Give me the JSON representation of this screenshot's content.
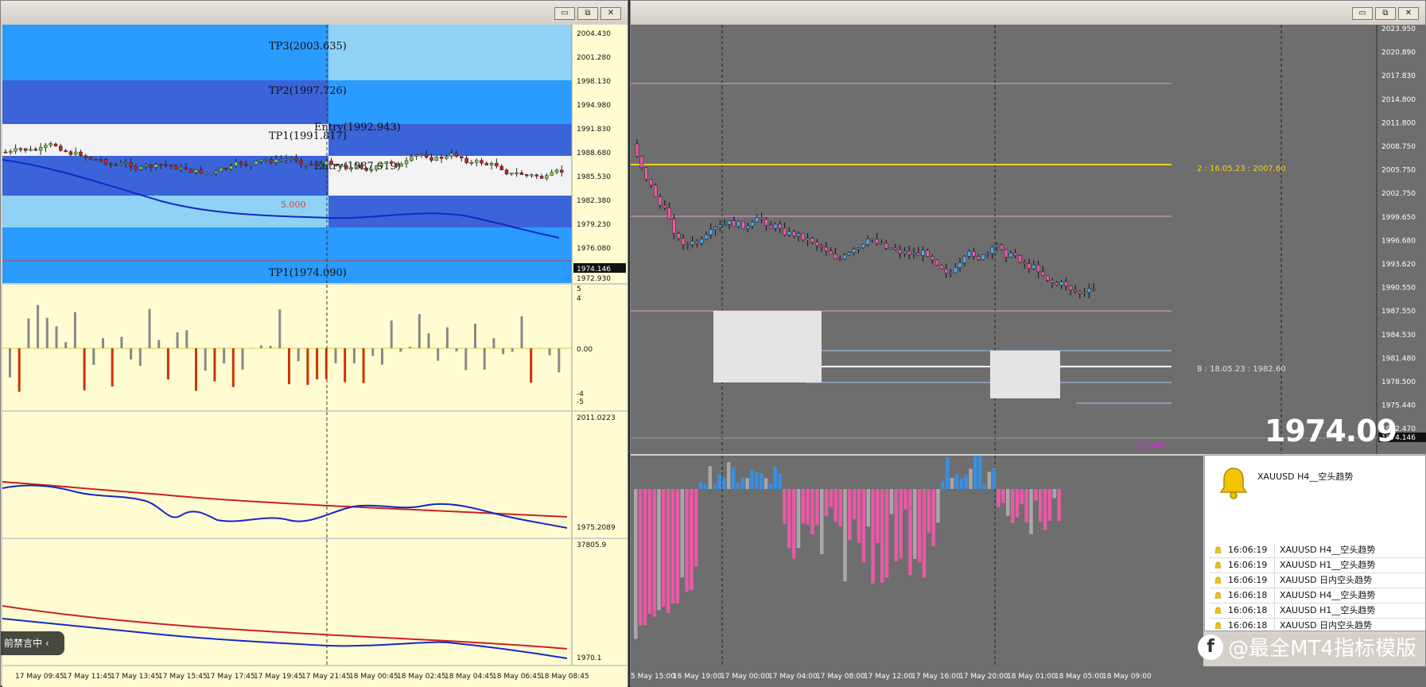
{
  "left_window": {
    "buttons": {
      "minimize": "▭",
      "restore": "⧉",
      "close": "✕"
    },
    "levels": [
      {
        "label": "TP3(2003.635)"
      },
      {
        "label": "TP2(1997.726)"
      },
      {
        "label": "Entry(1992.943)"
      },
      {
        "label": "TP1(1991.817)"
      },
      {
        "label": "Entry(1987.919)"
      },
      {
        "label": "5.000"
      },
      {
        "label": "TP1(1974.090)"
      }
    ],
    "price_axis": [
      "2004.430",
      "2001.280",
      "1998.130",
      "1994.980",
      "1991.830",
      "1988.680",
      "1985.530",
      "1982.380",
      "1979.230",
      "1976.080",
      "1972.930"
    ],
    "current_price": "1974.146",
    "panel1_axis": [
      "5",
      "4",
      "0.00",
      "-4",
      "-5"
    ],
    "panel2_axis": [
      "2011.0223",
      "1975.2089"
    ],
    "panel3_axis": [
      "37805.9",
      "1970.1"
    ],
    "time_axis": [
      "17 May 09:45",
      "17 May 11:45",
      "17 May 13:45",
      "17 May 15:45",
      "17 May 17:45",
      "17 May 19:45",
      "17 May 21:45",
      "18 May 00:45",
      "18 May 02:45",
      "18 May 04:45",
      "18 May 06:45",
      "18 May 08:45"
    ],
    "notice": "前禁言中"
  },
  "right_window": {
    "buttons": {
      "minimize": "▭",
      "restore": "⧉",
      "close": "✕"
    },
    "price_axis": [
      "2023.950",
      "2020.890",
      "2017.830",
      "2014.800",
      "2011.800",
      "2008.750",
      "2005.750",
      "2002.750",
      "1999.650",
      "1996.680",
      "1993.620",
      "1990.550",
      "1987.550",
      "1984.530",
      "1981.480",
      "1978.500",
      "1975.440",
      "1972.470"
    ],
    "current_price": "1974.146",
    "big_price": "1974.09",
    "label_upper": "2 : 16.05.23 : 2007.60",
    "label_lower": "8 : 18.05.23 : 1982.60",
    "delta_text": "-23.44",
    "time_axis": [
      "5 May 15:00",
      "16 May 19:00",
      "17 May 00:00",
      "17 May 04:00",
      "17 May 08:00",
      "17 May 12:00",
      "17 May 16:00",
      "17 May 20:00",
      "18 May 01:00",
      "18 May 05:00",
      "18 May 09:00"
    ]
  },
  "alerts": {
    "header": "XAUUSD  H4__空头趋势",
    "rows": [
      {
        "time": "16:06:19",
        "message": "XAUUSD  H4__空头趋势"
      },
      {
        "time": "16:06:19",
        "message": "XAUUSD  H1__空头趋势"
      },
      {
        "time": "16:06:19",
        "message": "XAUUSD  日内空头趋势"
      },
      {
        "time": "16:06:18",
        "message": "XAUUSD  H4__空头趋势"
      },
      {
        "time": "16:06:18",
        "message": "XAUUSD  H1__空头趋势"
      },
      {
        "time": "16:06:18",
        "message": "XAUUSD  日内空头趋势"
      }
    ]
  },
  "watermark": {
    "logo": "f",
    "text": "@最全MT4指标模版"
  },
  "colors": {
    "chart_bg_left": "#fffcd2",
    "chart_bg_right": "#6e6e6e",
    "band_dark": "#3a64d8",
    "band_mid": "#2a9bff",
    "band_light": "#8fd2f5",
    "ma_blue": "#1428c8",
    "signal_red": "#cc2020",
    "osc_pink": "#e85aa5",
    "osc_blue": "#3a8fe0",
    "osc_gray": "#a8a8a8",
    "level_yellow": "#f3d020"
  }
}
